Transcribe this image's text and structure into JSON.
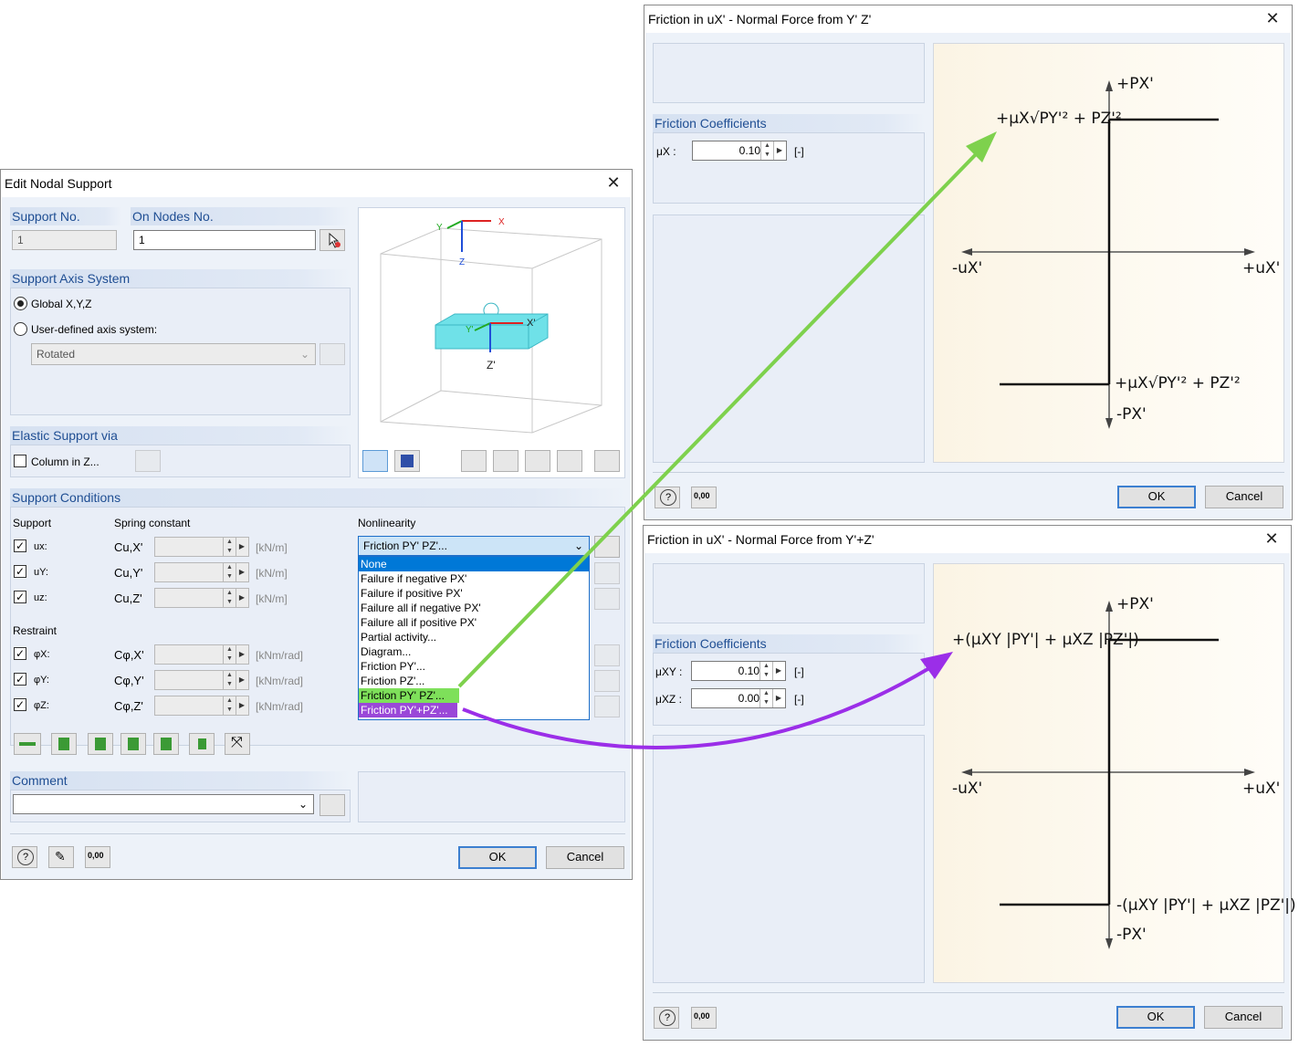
{
  "edit_dialog": {
    "title": "Edit Nodal Support",
    "support_no_label": "Support No.",
    "support_no_value": "1",
    "on_nodes_label": "On Nodes No.",
    "on_nodes_value": "1",
    "axis_system_header": "Support Axis System",
    "global_label": "Global X,Y,Z",
    "user_defined_label": "User-defined axis system:",
    "rotated_value": "Rotated",
    "elastic_header": "Elastic Support via",
    "column_label": "Column in Z...",
    "conditions_header": "Support Conditions",
    "col_support": "Support",
    "col_spring": "Spring constant",
    "col_nonlinearity": "Nonlinearity",
    "restraint_label": "Restraint",
    "rows": [
      {
        "check": "ux:",
        "sym": "Cu,X'",
        "unit": "[kN/m]"
      },
      {
        "check": "uY:",
        "sym": "Cu,Y'",
        "unit": "[kN/m]"
      },
      {
        "check": "uz:",
        "sym": "Cu,Z'",
        "unit": "[kN/m]"
      },
      {
        "check": "φX:",
        "sym": "Cφ,X'",
        "unit": "[kNm/rad]"
      },
      {
        "check": "φY:",
        "sym": "Cφ,Y'",
        "unit": "[kNm/rad]"
      },
      {
        "check": "φZ:",
        "sym": "Cφ,Z'",
        "unit": "[kNm/rad]"
      }
    ],
    "nonlinearity_selected": "Friction PY' PZ'...",
    "nonlinearity_options": [
      "None",
      "Failure if negative PX'",
      "Failure if positive PX'",
      "Failure all if negative PX'",
      "Failure all if positive PX'",
      "Partial activity...",
      "Diagram...",
      "Friction PY'...",
      "Friction PZ'...",
      "Friction PY' PZ'...",
      "Friction PY'+PZ'..."
    ],
    "comment_label": "Comment",
    "comment_value": "",
    "ok_label": "OK",
    "cancel_label": "Cancel",
    "preview_axes": {
      "x": "X",
      "y": "Y",
      "z": "Z",
      "lx": "X'",
      "ly": "Y'",
      "lz": "Z'"
    }
  },
  "friction1": {
    "title": "Friction in uX' - Normal Force from Y' Z'",
    "coeff_header": "Friction Coefficients",
    "mu_label": "μX :",
    "mu_value": "0.10",
    "unit": "[-]",
    "ok_label": "OK",
    "cancel_label": "Cancel",
    "graph": {
      "top_axis": "+PX'",
      "bottom_axis": "-PX'",
      "left_axis": "-uX'",
      "right_axis": "+uX'",
      "upper_formula": "+μX√PY'² + PZ'²",
      "lower_formula": "+μX√PY'² + PZ'²"
    }
  },
  "friction2": {
    "title": "Friction in uX' - Normal Force from Y'+Z'",
    "coeff_header": "Friction Coefficients",
    "mu1_label": "μXY :",
    "mu1_value": "0.10",
    "mu2_label": "μXZ :",
    "mu2_value": "0.00",
    "unit": "[-]",
    "ok_label": "OK",
    "cancel_label": "Cancel",
    "graph": {
      "top_axis": "+PX'",
      "bottom_axis": "-PX'",
      "left_axis": "-uX'",
      "right_axis": "+uX'",
      "upper_formula": "+(μXY |PY'| + μXZ |PZ'|)",
      "lower_formula": "-(μXY |PY'| + μXZ |PZ'|)"
    }
  },
  "colors": {
    "green_arrow": "#7ed14d",
    "purple_arrow": "#9b2ee8",
    "header_text": "#1f4e93",
    "selection": "#0078d7"
  }
}
